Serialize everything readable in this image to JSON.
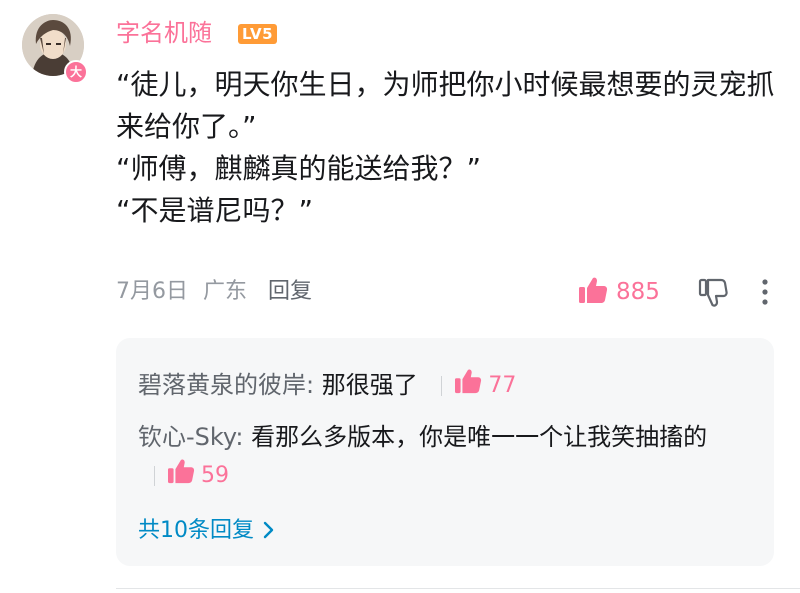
{
  "comment": {
    "username": "字名机随",
    "level": "LV5",
    "avatar_badge": "大",
    "lines": [
      "“徒儿，明天你生日，为师把你小时候最想要的灵宠抓来给你了。”",
      "“师傅，麒麟真的能送给我？”",
      "“不是谱尼吗？”"
    ],
    "date": "7月6日",
    "location": "广东",
    "reply_label": "回复",
    "like_count": "885"
  },
  "replies": [
    {
      "user": "碧落黄泉的彼岸: ",
      "text": "那很强了",
      "likes": "77"
    },
    {
      "user": "钦心-Sky: ",
      "text": "看那么多版本，你是唯一一个让我笑抽搐的",
      "likes": "59"
    }
  ],
  "more_replies_label": "共10条回复",
  "colors": {
    "accent_pink": "#fb7299",
    "link_blue": "#008ac5",
    "level_orange": "#ff9b36"
  },
  "icons": [
    "thumbs-up-icon",
    "thumbs-down-icon",
    "more-vertical-icon",
    "chevron-right-icon"
  ]
}
